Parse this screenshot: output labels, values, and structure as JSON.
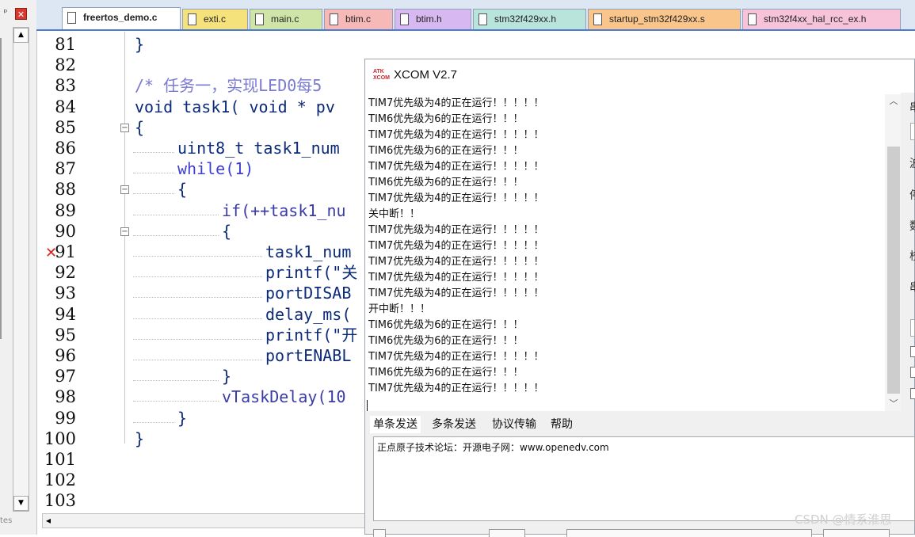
{
  "left_panel": {
    "pin_glyph": "ᵩ",
    "close_glyph": "✕",
    "scroll_up": "▲",
    "scroll_down": "▼",
    "status_text": "tes"
  },
  "tabs": [
    {
      "label": "freertos_demo.c",
      "active": true,
      "color": "#ffffff"
    },
    {
      "label": "exti.c",
      "active": false,
      "color": "#f5e27a"
    },
    {
      "label": "main.c",
      "active": false,
      "color": "#cfe5a8"
    },
    {
      "label": "btim.c",
      "active": false,
      "color": "#f7b8b8"
    },
    {
      "label": "btim.h",
      "active": false,
      "color": "#d8b8f0"
    },
    {
      "label": "stm32f429xx.h",
      "active": false,
      "color": "#b8e4dc"
    },
    {
      "label": "startup_stm32f429xx.s",
      "active": false,
      "color": "#f9c58a"
    },
    {
      "label": "stm32f4xx_hal_rcc_ex.h",
      "active": false,
      "color": "#f6c3d8"
    }
  ],
  "editor": {
    "lines": [
      {
        "num": "81",
        "text": "}"
      },
      {
        "num": "82",
        "text": ""
      },
      {
        "num": "83",
        "text": "/* 任务一，实现LED0每5"
      },
      {
        "num": "84",
        "text": "void task1( void * pv"
      },
      {
        "num": "85",
        "text": "{"
      },
      {
        "num": "86",
        "text": "uint8_t task1_num"
      },
      {
        "num": "87",
        "text": "while(1)"
      },
      {
        "num": "88",
        "text": "{"
      },
      {
        "num": "89",
        "text": "if(++task1_nu"
      },
      {
        "num": "90",
        "text": "{"
      },
      {
        "num": "91",
        "text": "task1_num"
      },
      {
        "num": "92",
        "text": "printf(\"关"
      },
      {
        "num": "93",
        "text": "portDISAB"
      },
      {
        "num": "94",
        "text": "delay_ms("
      },
      {
        "num": "95",
        "text": "printf(\"开"
      },
      {
        "num": "96",
        "text": "portENABL"
      },
      {
        "num": "97",
        "text": "}"
      },
      {
        "num": "98",
        "text": "vTaskDelay(10"
      },
      {
        "num": "99",
        "text": "}"
      },
      {
        "num": "100",
        "text": "}"
      },
      {
        "num": "101",
        "text": ""
      },
      {
        "num": "102",
        "text": ""
      },
      {
        "num": "103",
        "text": ""
      }
    ],
    "fold_glyph": "⊟",
    "error_glyph": "✕",
    "hscroll_left": "◂"
  },
  "xcom": {
    "title": "XCOM V2.7",
    "logo_text_top": "ATK",
    "logo_text_bottom": "XCOM",
    "receive_lines": [
      "TIM7优先级为4的正在运行！！！！！",
      "TIM6优先级为6的正在运行！！！",
      "TIM7优先级为4的正在运行！！！！！",
      "TIM6优先级为6的正在运行！！！",
      "TIM7优先级为4的正在运行！！！！！",
      "TIM6优先级为6的正在运行！！！",
      "TIM7优先级为4的正在运行！！！！！",
      "关中断！！",
      "TIM7优先级为4的正在运行！！！！！",
      "TIM7优先级为4的正在运行！！！！！",
      "TIM7优先级为4的正在运行！！！！！",
      "TIM7优先级为4的正在运行！！！！！",
      "TIM7优先级为4的正在运行！！！！！",
      "开中断！！！",
      "TIM6优先级为6的正在运行！！！",
      "TIM6优先级为6的正在运行！！！",
      "TIM7优先级为4的正在运行！！！！！",
      "TIM6优先级为6的正在运行！！！",
      "TIM7优先级为4的正在运行！！！！！"
    ],
    "scroll_up": "︿",
    "scroll_down": "﹀",
    "tabs": [
      "单条发送",
      "多条发送",
      "协议传输",
      "帮助"
    ],
    "send_text": "正点原子技术论坛：开源电子网：www.openedv.com"
  },
  "right_partial": {
    "chars": [
      "串",
      "波",
      "停",
      "数",
      "校",
      "串"
    ]
  },
  "watermark": "CSDN @情系淮思"
}
